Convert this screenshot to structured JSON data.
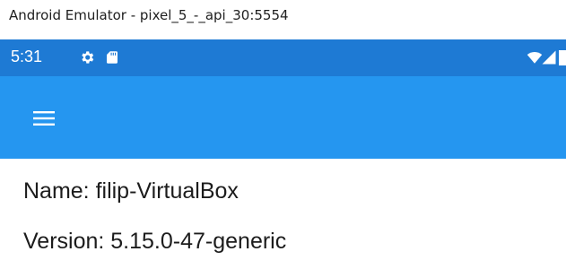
{
  "window": {
    "title": "Android Emulator - pixel_5_-_api_30:5554"
  },
  "status_bar": {
    "time": "5:31",
    "icons": [
      "gear-icon",
      "sd-card-icon",
      "wifi-icon",
      "cell-signal-icon",
      "battery-icon"
    ]
  },
  "app_bar": {
    "menu_icon": "hamburger-menu-icon"
  },
  "content": {
    "name_line": "Name: filip-VirtualBox",
    "version_line": "Version: 5.15.0-47-generic"
  },
  "colors": {
    "status_bar": "#1e7ad4",
    "app_bar": "#2596f0",
    "text": "#1c1c1c"
  }
}
